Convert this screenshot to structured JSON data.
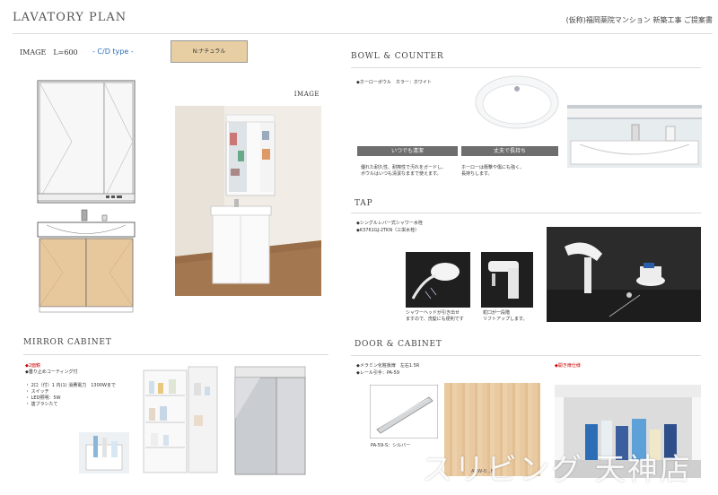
{
  "header": {
    "title": "LAVATORY PLAN",
    "subtitle": "(仮称)福岡薬院マンション 新築工事 ご提案書"
  },
  "image_section": {
    "label": "IMAGE　L=600",
    "type_label": "- C/D type -",
    "swatch_label": "N:ナチュラル",
    "photo_label": "IMAGE"
  },
  "bowl_counter": {
    "title": "BOWL & COUNTER",
    "spec": "◆ホーローボウル　カラー：ホワイト",
    "btn1": "いつでも清潔",
    "btn2": "丈夫で長持ち",
    "desc1": "優れた耐久性、耐擦性で汚れをガードし、\nボウルはいつも清潔なままで使えます。",
    "desc2": "ホーローは衝撃や傷にも強く、\n長持ちします。"
  },
  "tap": {
    "title": "TAP",
    "spec1": "◆シングルレバー式シャワー水栓",
    "spec2": "◆K3761GJ-2TKN（三栄水栓）",
    "cap1": "シャワーヘッドが引き出せ\nますので、洗髪にも便利です",
    "cap2": "蛇口が一段階\nリフトアップします。"
  },
  "mirror_cabinet": {
    "title": "MIRROR CABINET",
    "spec1": "◆2面鏡",
    "spec2": "◆曇り止めコーティング付",
    "list": "・ 2口（付）1 内(1) 消費電力　1300Wまで\n・ スイッチ\n・ LED照明：5W\n・ 歯ブラシたて"
  },
  "door_cabinet": {
    "title": "DOOR & CABINET",
    "spec1": "◆メラミン化粧板扉　左右1.5R",
    "spec2": "◆レール引手：PA-59",
    "handle_caption": "PA-59-S：シルバー",
    "wood_caption": "ANW-0...N",
    "open_label": "◆開き扉仕様"
  },
  "watermark": "スリビング 天神店"
}
